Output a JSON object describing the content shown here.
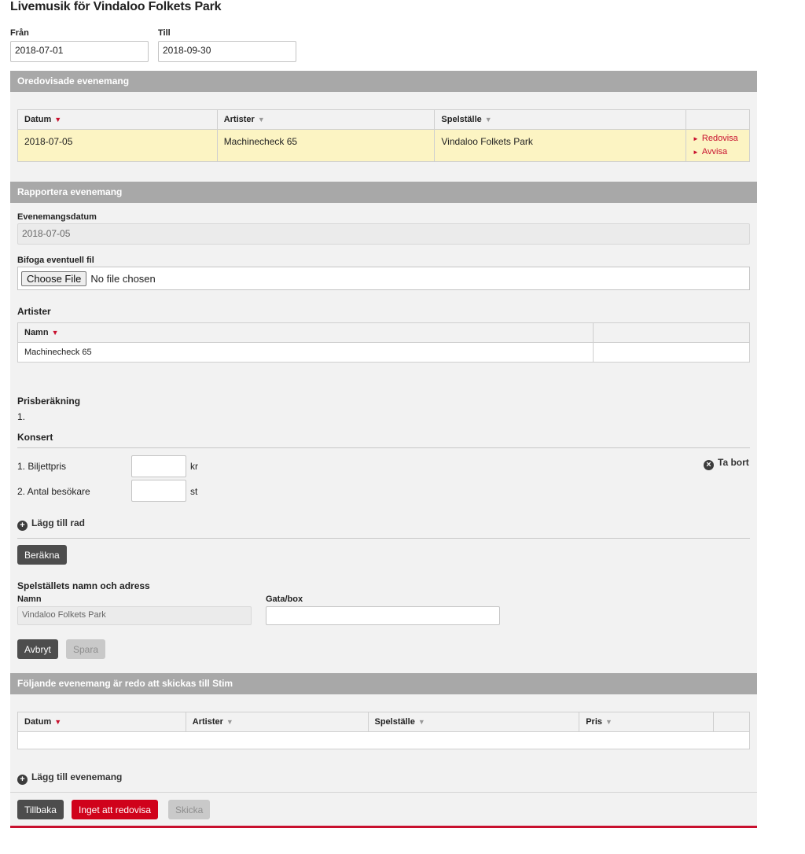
{
  "page": {
    "title": "Livemusik för Vindaloo Folkets Park"
  },
  "date_range": {
    "from_label": "Från",
    "from_value": "2018-07-01",
    "to_label": "Till",
    "to_value": "2018-09-30"
  },
  "unreported": {
    "header": "Oredovisade evenemang",
    "columns": [
      "Datum",
      "Artister",
      "Spelställe",
      ""
    ],
    "rows": [
      {
        "date": "2018-07-05",
        "artist": "Machinecheck 65",
        "venue": "Vindaloo Folkets Park",
        "actions": [
          "Redovisa",
          "Avvisa"
        ]
      }
    ]
  },
  "report": {
    "header": "Rapportera evenemang",
    "event_date_label": "Evenemangsdatum",
    "event_date_value": "2018-07-05",
    "attach_label": "Bifoga eventuell fil",
    "file_button": "Choose File",
    "file_status": "No file chosen",
    "artists_title": "Artister",
    "artists_columns": [
      "Namn",
      ""
    ],
    "artists_rows": [
      {
        "name": "Machinecheck 65"
      }
    ],
    "price_title": "Prisberäkning",
    "price_index": "1.",
    "concert_title": "Konsert",
    "remove_label": "Ta bort",
    "rows": [
      {
        "label": "1. Biljettpris",
        "unit": "kr",
        "value": ""
      },
      {
        "label": "2. Antal besökare",
        "unit": "st",
        "value": ""
      }
    ],
    "add_row_label": "Lägg till rad",
    "calc_button": "Beräkna",
    "venue_title": "Spelställets namn och adress",
    "name_label": "Namn",
    "name_value": "Vindaloo Folkets Park",
    "street_label": "Gata/box",
    "street_value": "",
    "cancel_button": "Avbryt",
    "save_button": "Spara"
  },
  "ready": {
    "header": "Följande evenemang är redo att skickas till Stim",
    "columns": [
      "Datum",
      "Artister",
      "Spelställe",
      "Pris",
      ""
    ],
    "add_event_label": "Lägg till evenemang"
  },
  "footer": {
    "back_button": "Tillbaka",
    "nothing_button": "Inget att redovisa",
    "send_button": "Skicka"
  },
  "colors": {
    "accent_red": "#c8102e",
    "section_header": "#a8a8a8",
    "highlight_row": "#fcf4c3"
  }
}
